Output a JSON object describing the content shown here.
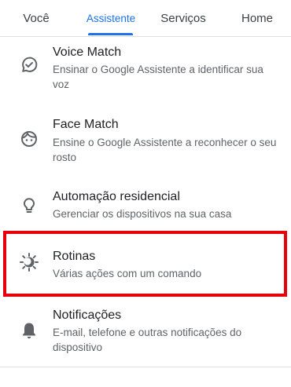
{
  "tabs": [
    {
      "label": "Você",
      "active": false
    },
    {
      "label": "Assistente",
      "active": true
    },
    {
      "label": "Serviços",
      "active": false
    },
    {
      "label": "Home",
      "active": false
    }
  ],
  "items": [
    {
      "title": "Voice Match",
      "subtitle": "Ensinar o Google Assistente a identificar sua voz",
      "icon": "voice-match-check-icon"
    },
    {
      "title": "Face Match",
      "subtitle": "Ensine o Google Assistente a reconhecer o seu rosto",
      "icon": "face-icon"
    },
    {
      "title": "Automação residencial",
      "subtitle": "Gerenciar os dispositivos na sua casa",
      "icon": "lightbulb-icon"
    },
    {
      "title": "Rotinas",
      "subtitle": "Várias ações com um comando",
      "icon": "routine-sun-icon",
      "highlighted": true
    },
    {
      "title": "Notificações",
      "subtitle": "E-mail, telefone e outras notificações do dispositivo",
      "icon": "bell-icon"
    }
  ],
  "colors": {
    "accent": "#1a73e8",
    "highlight_border": "#e8000a",
    "icon": "#5f6368"
  }
}
